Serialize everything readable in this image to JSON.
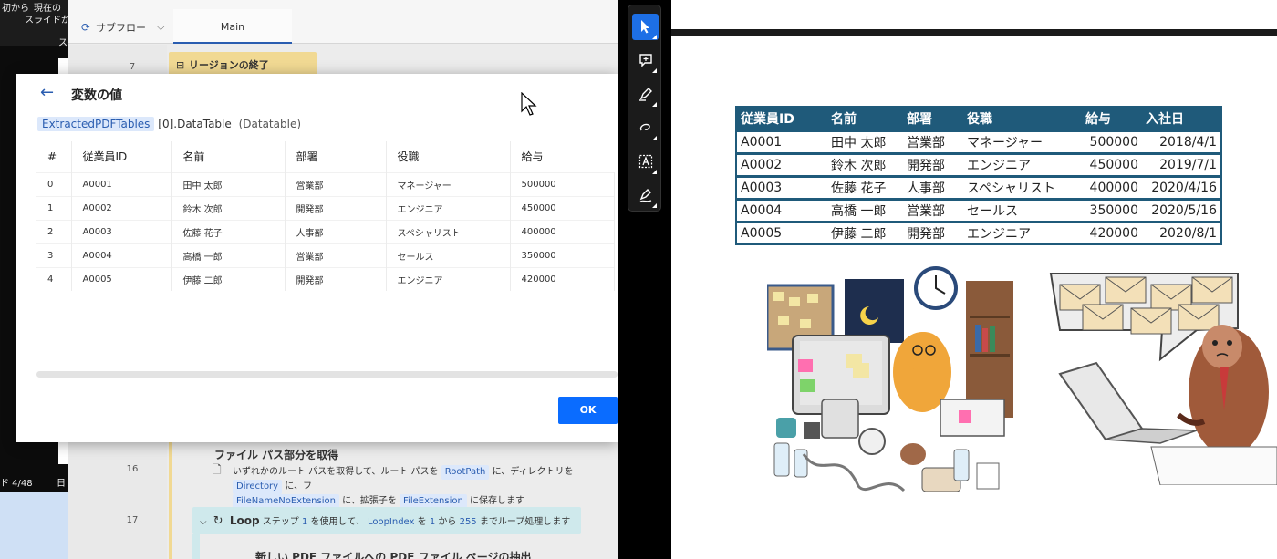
{
  "left_strip": {
    "text_a": "初から",
    "text_b": "現在の",
    "text_c": "スライドから",
    "text_d": "ス",
    "status": "ド 4/48",
    "status2": "日"
  },
  "designer": {
    "subflow_label": "サブフロー",
    "tab_main": "Main",
    "line7": "7",
    "line16": "16",
    "line17": "17",
    "region_end": "リージョンの終了",
    "action16": {
      "title": "ファイル パス部分を取得",
      "t1": "いずれかのルート パスを取得して、ルート パスを",
      "v1": "RootPath",
      "t2": "に、ディレクトリを",
      "v2": "Directory",
      "t3": "に、フ",
      "v3": "FileNameNoExtension",
      "t4": "に、拡張子を",
      "v4": "FileExtension",
      "t5": "に保存します"
    },
    "loop": {
      "title": "Loop",
      "t1": "ステップ",
      "n1": "1",
      "t2": "を使用して、",
      "v1": "LoopIndex",
      "t3": "を",
      "n2": "1",
      "t4": "から",
      "n3": "255",
      "t5": "までループ処理します"
    },
    "next_action": "新しい PDF ファイルへの PDF ファイル ページの抽出"
  },
  "dialog": {
    "title": "変数の値",
    "path_var": "ExtractedPDFTables",
    "path_rest": "[0].DataTable",
    "path_type": "(Datatable)",
    "columns": [
      "#",
      "従業員ID",
      "名前",
      "部署",
      "役職",
      "給与"
    ],
    "rows": [
      [
        "0",
        "A0001",
        "田中 太郎",
        "営業部",
        "マネージャー",
        "500000"
      ],
      [
        "1",
        "A0002",
        "鈴木 次郎",
        "開発部",
        "エンジニア",
        "450000"
      ],
      [
        "2",
        "A0003",
        "佐藤 花子",
        "人事部",
        "スペシャリスト",
        "400000"
      ],
      [
        "3",
        "A0004",
        "高橋 一郎",
        "営業部",
        "セールス",
        "350000"
      ],
      [
        "4",
        "A0005",
        "伊藤 二郎",
        "開発部",
        "エンジニア",
        "420000"
      ]
    ],
    "ok_label": "OK"
  },
  "toolbar": {
    "tools": [
      "select-tool",
      "comment-tool",
      "highlight-tool",
      "draw-tool",
      "text-select-tool",
      "sign-tool"
    ]
  },
  "slide": {
    "columns": [
      "従業員ID",
      "名前",
      "部署",
      "役職",
      "給与",
      "入社日"
    ],
    "rows": [
      [
        "A0001",
        "田中 太郎",
        "営業部",
        "マネージャー",
        "500000",
        "2018/4/1"
      ],
      [
        "A0002",
        "鈴木 次郎",
        "開発部",
        "エンジニア",
        "450000",
        "2019/7/1"
      ],
      [
        "A0003",
        "佐藤 花子",
        "人事部",
        "スペシャリスト",
        "400000",
        "2020/4/16"
      ],
      [
        "A0004",
        "高橋 一郎",
        "営業部",
        "セールス",
        "350000",
        "2020/5/16"
      ],
      [
        "A0005",
        "伊藤 二郎",
        "開発部",
        "エンジニア",
        "420000",
        "2020/8/1"
      ]
    ],
    "header_color": "#1f5a7a"
  },
  "colors": {
    "accent": "#0a6cff",
    "region": "#f1d993",
    "loop": "#cfe9ec",
    "variable_bg": "#dce8fb"
  }
}
